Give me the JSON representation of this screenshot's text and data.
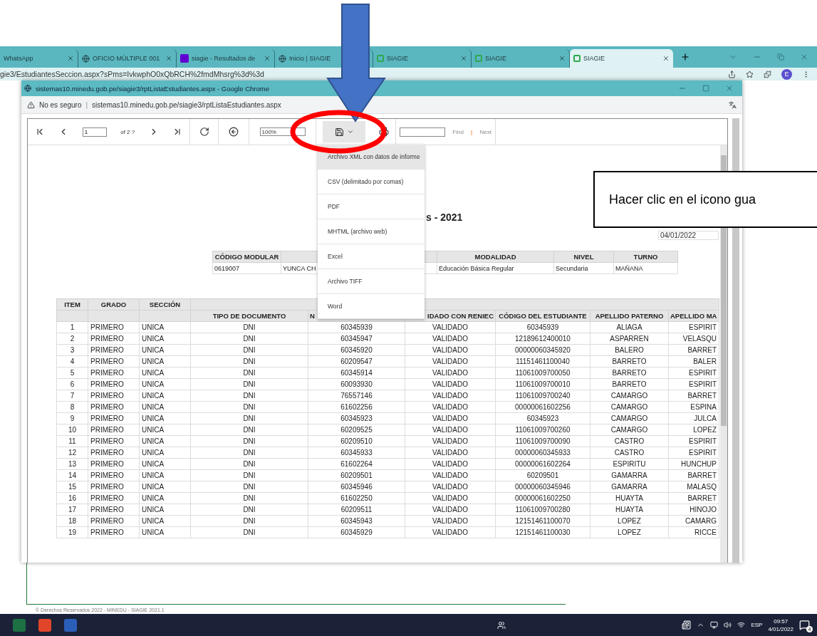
{
  "browser": {
    "tabs": [
      {
        "label": "WhatsApp",
        "kind": "plain",
        "selected": false
      },
      {
        "label": "OFICIO MÚLTIPLE 001",
        "kind": "globe",
        "selected": false
      },
      {
        "label": "siagie - Resultados de",
        "kind": "yahoo",
        "selected": false
      },
      {
        "label": "Inicio | SIAGIE",
        "kind": "globe",
        "selected": false
      },
      {
        "label": "SIAGIE",
        "kind": "siagie",
        "selected": false
      },
      {
        "label": "SIAGIE",
        "kind": "siagie",
        "selected": false
      },
      {
        "label": "SIAGIE",
        "kind": "siagie",
        "selected": true
      }
    ],
    "address": "gie3/EstudiantesSeccion.aspx?sPms=IvkwphO0xQbRCH%2fmdMhsrg%3d%3d",
    "profile_initial": "E",
    "footer": "© Derechos Reservados 2022 - MINEDU - SIAGIE 2021.1"
  },
  "popup": {
    "title": "sistemas10.minedu.gob.pe/siagie3/rptListaEstudiantes.aspx - Google Chrome",
    "security": "No es seguro",
    "separator": "|",
    "url": "sistemas10.minedu.gob.pe/siagie3/rptListaEstudiantes.aspx"
  },
  "toolbar": {
    "page": "1",
    "page_of": "of 2 ?",
    "zoom": "100%",
    "find": "Find",
    "find_separator": "|",
    "next": "Next"
  },
  "export_menu": [
    {
      "label": "Archivo XML con datos de informe",
      "selected": true
    },
    {
      "label": "CSV (delimitado por comas)",
      "selected": false
    },
    {
      "label": "PDF",
      "selected": false
    },
    {
      "label": "MHTML (archivo web)",
      "selected": false
    },
    {
      "label": "Excel",
      "selected": false
    },
    {
      "label": "Archivo TIFF",
      "selected": false
    },
    {
      "label": "Word",
      "selected": false
    }
  ],
  "report": {
    "title": "s - 2021",
    "date": "04/01/2022",
    "info_columns": [
      "CÓDIGO MODULAR",
      "",
      "MODALIDAD",
      "NIVEL",
      "TURNO"
    ],
    "info_values": [
      "0619007",
      "YUNCA CH",
      "Educación Básica Regular",
      "Secundaria",
      "MAÑANA"
    ],
    "group_headers": [
      "ITEM",
      "GRADO",
      "SECCIÓN"
    ],
    "columns": [
      "",
      "",
      "",
      "TIPO DE DOCUMENTO",
      "N",
      "IDADO CON RENIEC",
      "CÓDIGO DEL ESTUDIANTE",
      "APELLIDO PATERNO",
      "APELLIDO MA"
    ],
    "rows": [
      [
        "1",
        "PRIMERO",
        "UNICA",
        "DNI",
        "60345939",
        "VALIDADO",
        "60345939",
        "ALIAGA",
        "ESPIRIT"
      ],
      [
        "2",
        "PRIMERO",
        "UNICA",
        "DNI",
        "60345947",
        "VALIDADO",
        "12189612400010",
        "ASPARREN",
        "VELASQU"
      ],
      [
        "3",
        "PRIMERO",
        "UNICA",
        "DNI",
        "60345920",
        "VALIDADO",
        "00000060345920",
        "BALERO",
        "BARRET"
      ],
      [
        "4",
        "PRIMERO",
        "UNICA",
        "DNI",
        "60209547",
        "VALIDADO",
        "11151461100040",
        "BARRETO",
        "BALER"
      ],
      [
        "5",
        "PRIMERO",
        "UNICA",
        "DNI",
        "60345914",
        "VALIDADO",
        "11061009700050",
        "BARRETO",
        "ESPIRIT"
      ],
      [
        "6",
        "PRIMERO",
        "UNICA",
        "DNI",
        "60093930",
        "VALIDADO",
        "11061009700010",
        "BARRETO",
        "ESPIRIT"
      ],
      [
        "7",
        "PRIMERO",
        "UNICA",
        "DNI",
        "76557146",
        "VALIDADO",
        "11061009700240",
        "CAMARGO",
        "BARRET"
      ],
      [
        "8",
        "PRIMERO",
        "UNICA",
        "DNI",
        "61602256",
        "VALIDADO",
        "00000061602256",
        "CAMARGO",
        "ESPINA"
      ],
      [
        "9",
        "PRIMERO",
        "UNICA",
        "DNI",
        "60345923",
        "VALIDADO",
        "60345923",
        "CAMARGO",
        "JULCA"
      ],
      [
        "10",
        "PRIMERO",
        "UNICA",
        "DNI",
        "60209525",
        "VALIDADO",
        "11061009700260",
        "CAMARGO",
        "LOPEZ"
      ],
      [
        "11",
        "PRIMERO",
        "UNICA",
        "DNI",
        "60209510",
        "VALIDADO",
        "11061009700090",
        "CASTRO",
        "ESPIRIT"
      ],
      [
        "12",
        "PRIMERO",
        "UNICA",
        "DNI",
        "60345933",
        "VALIDADO",
        "00000060345933",
        "CASTRO",
        "ESPIRIT"
      ],
      [
        "13",
        "PRIMERO",
        "UNICA",
        "DNI",
        "61602264",
        "VALIDADO",
        "00000061602264",
        "ESPIRITU",
        "HUNCHUP"
      ],
      [
        "14",
        "PRIMERO",
        "UNICA",
        "DNI",
        "60209501",
        "VALIDADO",
        "60209501",
        "GAMARRA",
        "BARRET"
      ],
      [
        "15",
        "PRIMERO",
        "UNICA",
        "DNI",
        "60345946",
        "VALIDADO",
        "00000060345946",
        "GAMARRA",
        "MALASQ"
      ],
      [
        "16",
        "PRIMERO",
        "UNICA",
        "DNI",
        "61602250",
        "VALIDADO",
        "00000061602250",
        "HUAYTA",
        "BARRET"
      ],
      [
        "17",
        "PRIMERO",
        "UNICA",
        "DNI",
        "60209511",
        "VALIDADO",
        "11061009700280",
        "HUAYTA",
        "HINOJO"
      ],
      [
        "18",
        "PRIMERO",
        "UNICA",
        "DNI",
        "60345943",
        "VALIDADO",
        "12151461100070",
        "LOPEZ",
        "CAMARG"
      ],
      [
        "19",
        "PRIMERO",
        "UNICA",
        "DNI",
        "60345929",
        "VALIDADO",
        "12151461100030",
        "LOPEZ",
        "RICCE"
      ]
    ]
  },
  "callout": "Hacer clic en el icono gua",
  "taskbar": {
    "apps": [
      {
        "kind": "excel"
      },
      {
        "kind": "acrobat"
      },
      {
        "kind": "word"
      }
    ],
    "language": "ESP",
    "time": "09:57",
    "date": "4/01/2022",
    "notifications": "4"
  }
}
